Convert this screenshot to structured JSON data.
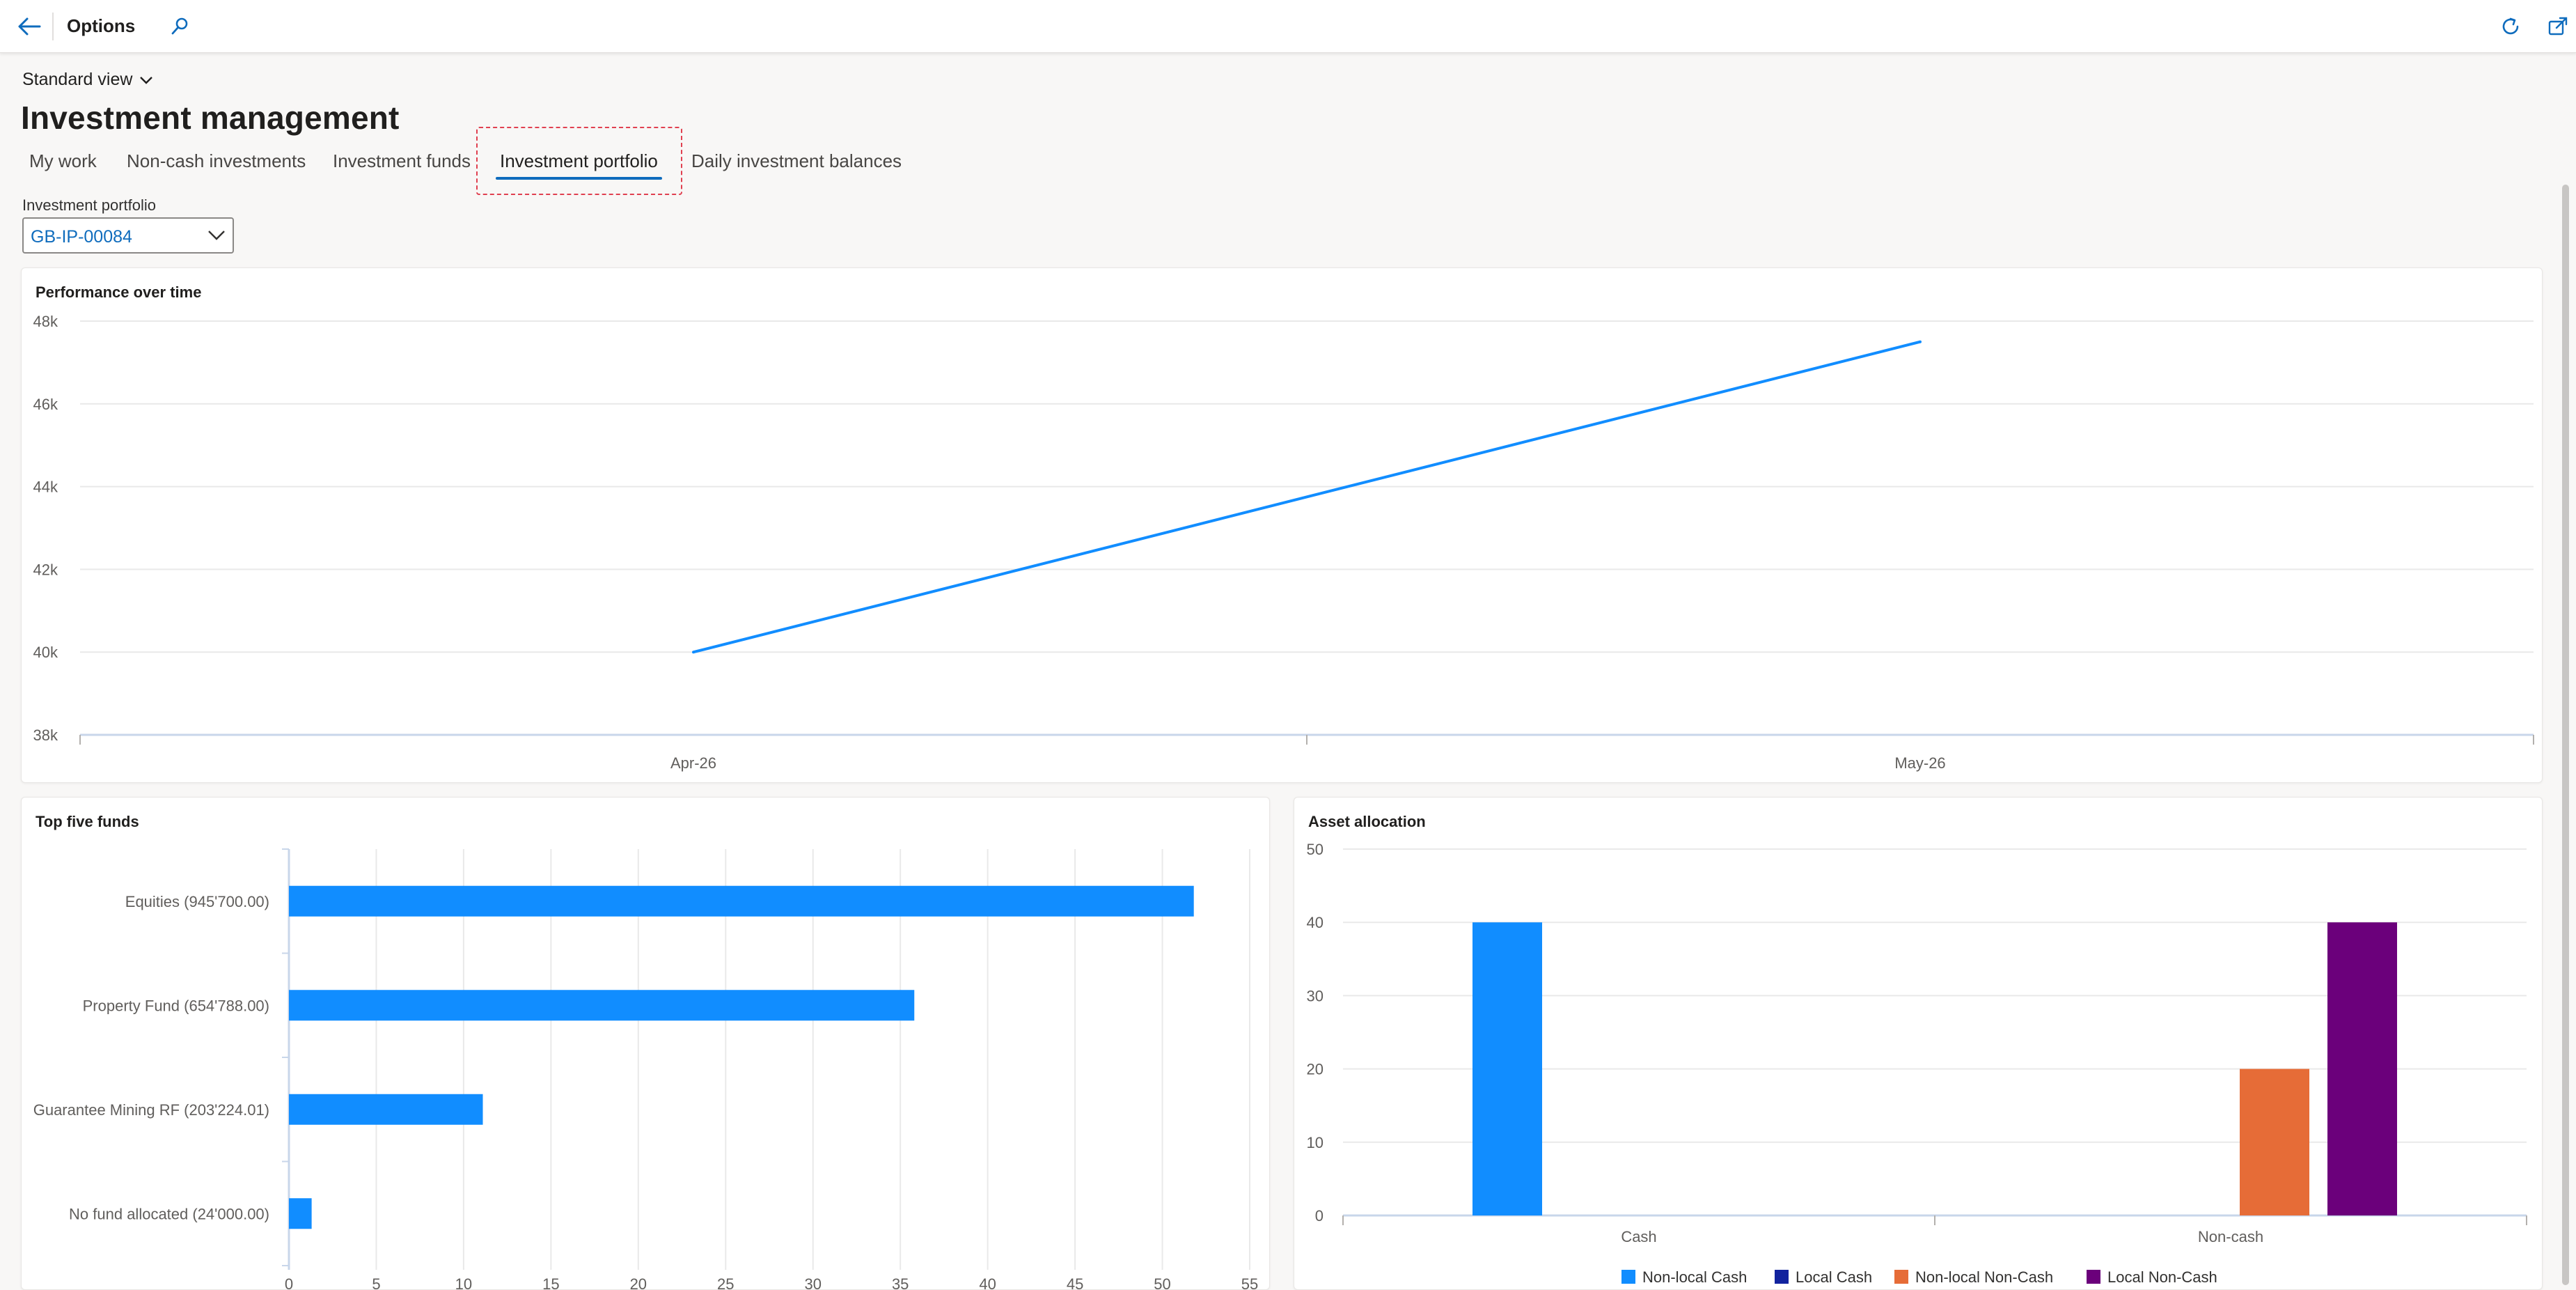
{
  "topbar": {
    "title": "Options",
    "icons": [
      "back-arrow-icon",
      "search-icon",
      "refresh-icon",
      "open-in-new-icon"
    ]
  },
  "view": {
    "label": "Standard view"
  },
  "page": {
    "title": "Investment management"
  },
  "tabs": [
    {
      "label": "My work",
      "active": false
    },
    {
      "label": "Non-cash investments",
      "active": false
    },
    {
      "label": "Investment funds",
      "active": false
    },
    {
      "label": "Investment portfolio",
      "active": true
    },
    {
      "label": "Daily investment balances",
      "active": false
    }
  ],
  "portfolio": {
    "label": "Investment portfolio",
    "value": "GB-IP-00084"
  },
  "colors": {
    "accent": "#0f6cbd",
    "series_blue": "#118dff",
    "local_cash": "#12239e",
    "nonlocal_noncash": "#e66c37",
    "local_noncash": "#6b007b"
  },
  "charts": {
    "performance": {
      "title": "Performance over time"
    },
    "top_funds": {
      "title": "Top five funds"
    },
    "allocation": {
      "title": "Asset allocation"
    }
  },
  "chart_data": [
    {
      "id": "performance",
      "type": "line",
      "title": "Performance over time",
      "x": [
        "Apr-26",
        "May-26"
      ],
      "series": [
        {
          "values": [
            40000,
            47500
          ]
        }
      ],
      "yticks": [
        "38k",
        "40k",
        "42k",
        "44k",
        "46k",
        "48k"
      ],
      "ylim": [
        38000,
        48000
      ],
      "grid": true
    },
    {
      "id": "top_funds",
      "type": "bar",
      "orientation": "horizontal",
      "title": "Top five funds",
      "categories": [
        "Equities (945'700.00)",
        "Property Fund (654'788.00)",
        "Guarantee Mining RF (203'224.01)",
        "No fund allocated (24'000.00)"
      ],
      "values": [
        51.8,
        35.8,
        11.1,
        1.3
      ],
      "xticks": [
        "0",
        "5",
        "10",
        "15",
        "20",
        "25",
        "30",
        "35",
        "40",
        "45",
        "50",
        "55"
      ],
      "xlim": [
        0,
        55
      ],
      "grid": true
    },
    {
      "id": "allocation",
      "type": "bar",
      "title": "Asset allocation",
      "categories": [
        "Cash",
        "Non-cash"
      ],
      "series": [
        {
          "name": "Non-local Cash",
          "values": [
            40,
            0
          ]
        },
        {
          "name": "Local Cash",
          "values": [
            0,
            0
          ]
        },
        {
          "name": "Non-local Non-Cash",
          "values": [
            0,
            20
          ]
        },
        {
          "name": "Local Non-Cash",
          "values": [
            0,
            40
          ]
        }
      ],
      "yticks": [
        "0",
        "10",
        "20",
        "30",
        "40",
        "50"
      ],
      "ylim": [
        0,
        50
      ],
      "legend": "bottom",
      "grid": true
    }
  ]
}
